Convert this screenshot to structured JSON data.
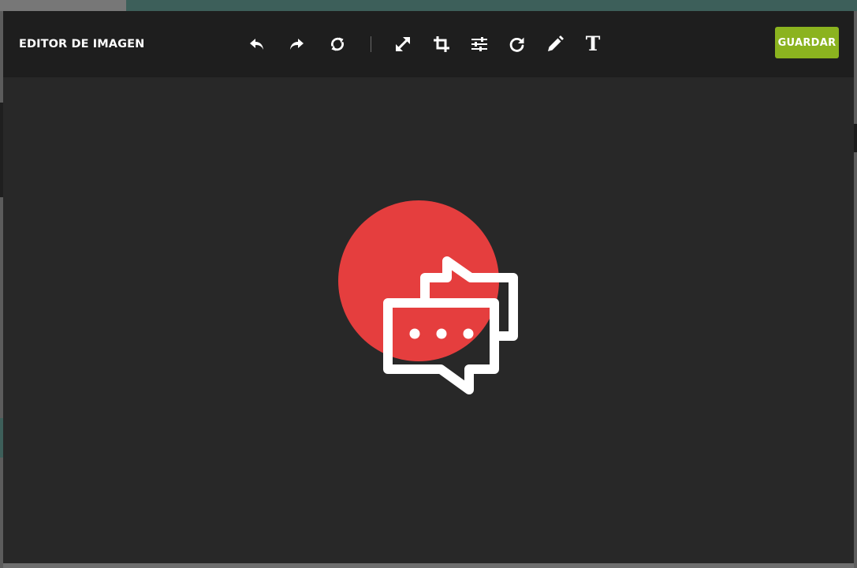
{
  "editor": {
    "title": "EDITOR DE IMAGEN",
    "save_label": "GUARDAR"
  },
  "toolbar": {
    "tools": [
      {
        "name": "undo",
        "icon": "undo-icon"
      },
      {
        "name": "redo",
        "icon": "redo-icon"
      },
      {
        "name": "reset",
        "icon": "refresh-icon"
      },
      {
        "name": "resize",
        "icon": "expand-icon"
      },
      {
        "name": "crop",
        "icon": "crop-icon"
      },
      {
        "name": "adjust",
        "icon": "sliders-icon"
      },
      {
        "name": "rotate",
        "icon": "rotate-icon"
      },
      {
        "name": "draw",
        "icon": "pencil-icon"
      },
      {
        "name": "text",
        "icon": "text-icon",
        "glyph": "T"
      }
    ]
  },
  "image": {
    "description_icon": "chat-bubbles-icon"
  },
  "colors": {
    "accent": "#8bb31f",
    "toolbar_bg": "#1e1e1e",
    "canvas_bg": "#282828",
    "image_circle": "#e53e3e",
    "icon": "#ffffff"
  }
}
